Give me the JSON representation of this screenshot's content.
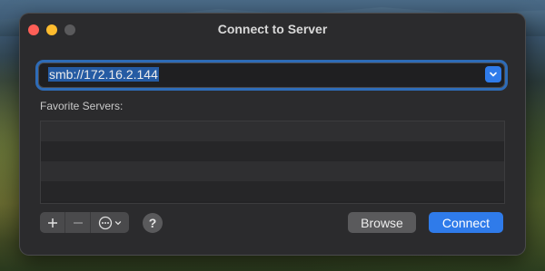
{
  "window": {
    "title": "Connect to Server"
  },
  "address": {
    "value": "smb://172.16.2.144"
  },
  "favorites": {
    "label": "Favorite Servers:",
    "rows": [
      "",
      "",
      "",
      ""
    ]
  },
  "controls": {
    "add_icon": "plus-icon",
    "remove_icon": "minus-icon",
    "more_icon": "ellipsis-circle-icon",
    "help_label": "?",
    "browse_label": "Browse",
    "connect_label": "Connect"
  },
  "colors": {
    "accent": "#2f7bea",
    "window_bg": "#2b2b2d",
    "close": "#ff5f57",
    "minimize": "#febc2e"
  }
}
